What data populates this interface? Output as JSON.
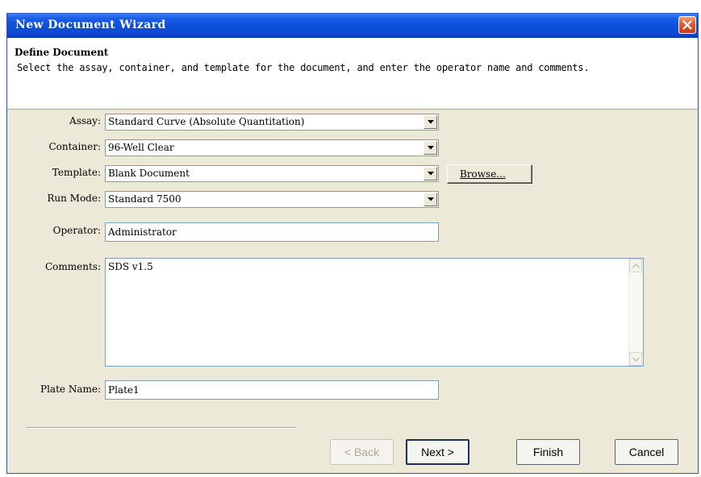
{
  "window": {
    "title": "New Document Wizard"
  },
  "header": {
    "title": "Define Document",
    "description": "Select the assay, container, and template for the document, and enter the operator name and comments."
  },
  "form": {
    "assay": {
      "label": "Assay:",
      "value": "Standard Curve (Absolute Quantitation)"
    },
    "container": {
      "label": "Container:",
      "value": "96-Well Clear"
    },
    "template": {
      "label": "Template:",
      "value": "Blank Document",
      "browse_label": "Browse..."
    },
    "run_mode": {
      "label": "Run Mode:",
      "value": "Standard 7500"
    },
    "operator": {
      "label": "Operator:",
      "value": "Administrator"
    },
    "comments": {
      "label": "Comments:",
      "value": "SDS v1.5"
    },
    "plate_name": {
      "label": "Plate Name:",
      "value": "Plate1"
    }
  },
  "buttons": {
    "back": "< Back",
    "next": "Next >",
    "finish": "Finish",
    "cancel": "Cancel"
  },
  "icons": {
    "close": "close-icon",
    "dropdown": "chevron-down-icon",
    "scroll_up": "scroll-up-icon",
    "scroll_down": "scroll-down-icon"
  },
  "colors": {
    "titlebar": "#0a4fd8",
    "close": "#e0603a",
    "dialog_bg": "#ece9d8",
    "field_border": "#7f9db9"
  }
}
